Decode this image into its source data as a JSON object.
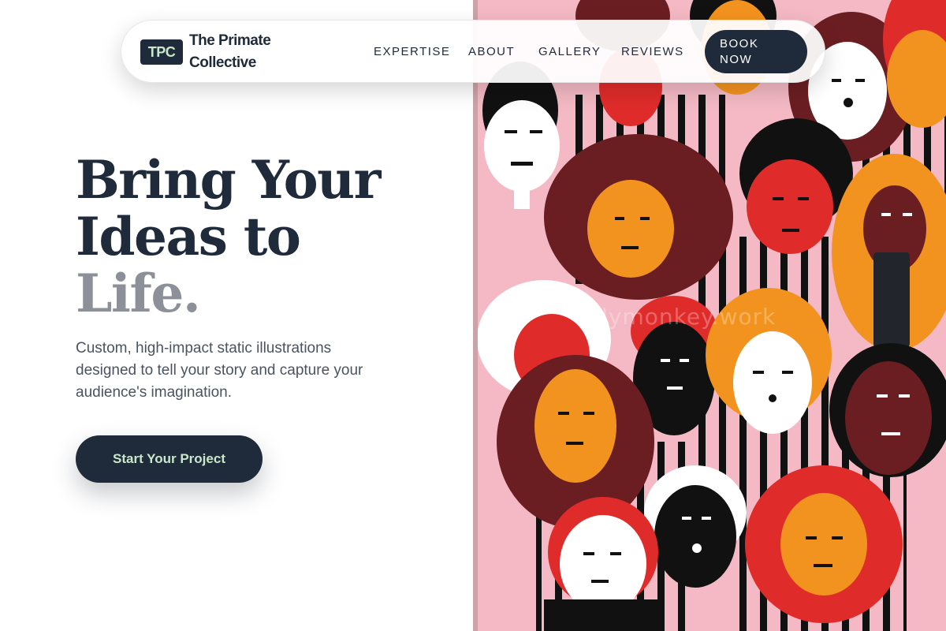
{
  "nav": {
    "logo_badge": "TPC",
    "brand_line1": "The Primate",
    "brand_line2": "Collective",
    "links": [
      "EXPERTISE",
      "ABOUT",
      "GALLERY",
      "REVIEWS"
    ],
    "book_line1": "BOOK",
    "book_line2": "NOW"
  },
  "hero": {
    "title_line1": "Bring Your",
    "title_line2": "Ideas to",
    "title_line3": "Life.",
    "subtitle": "Custom, high-impact static illustrations designed to tell your story and capture your audience's imagination.",
    "cta_label": "Start Your Project"
  },
  "art": {
    "watermark": "sillymonkey.work"
  },
  "colors": {
    "navy": "#1f2a3b",
    "mint": "#c9e8c9",
    "muted": "#8e9099",
    "mural_pink": "#f4b9c4",
    "mural_orange": "#f3931f",
    "mural_red": "#e02b2b",
    "mural_maroon": "#6b1e22"
  }
}
